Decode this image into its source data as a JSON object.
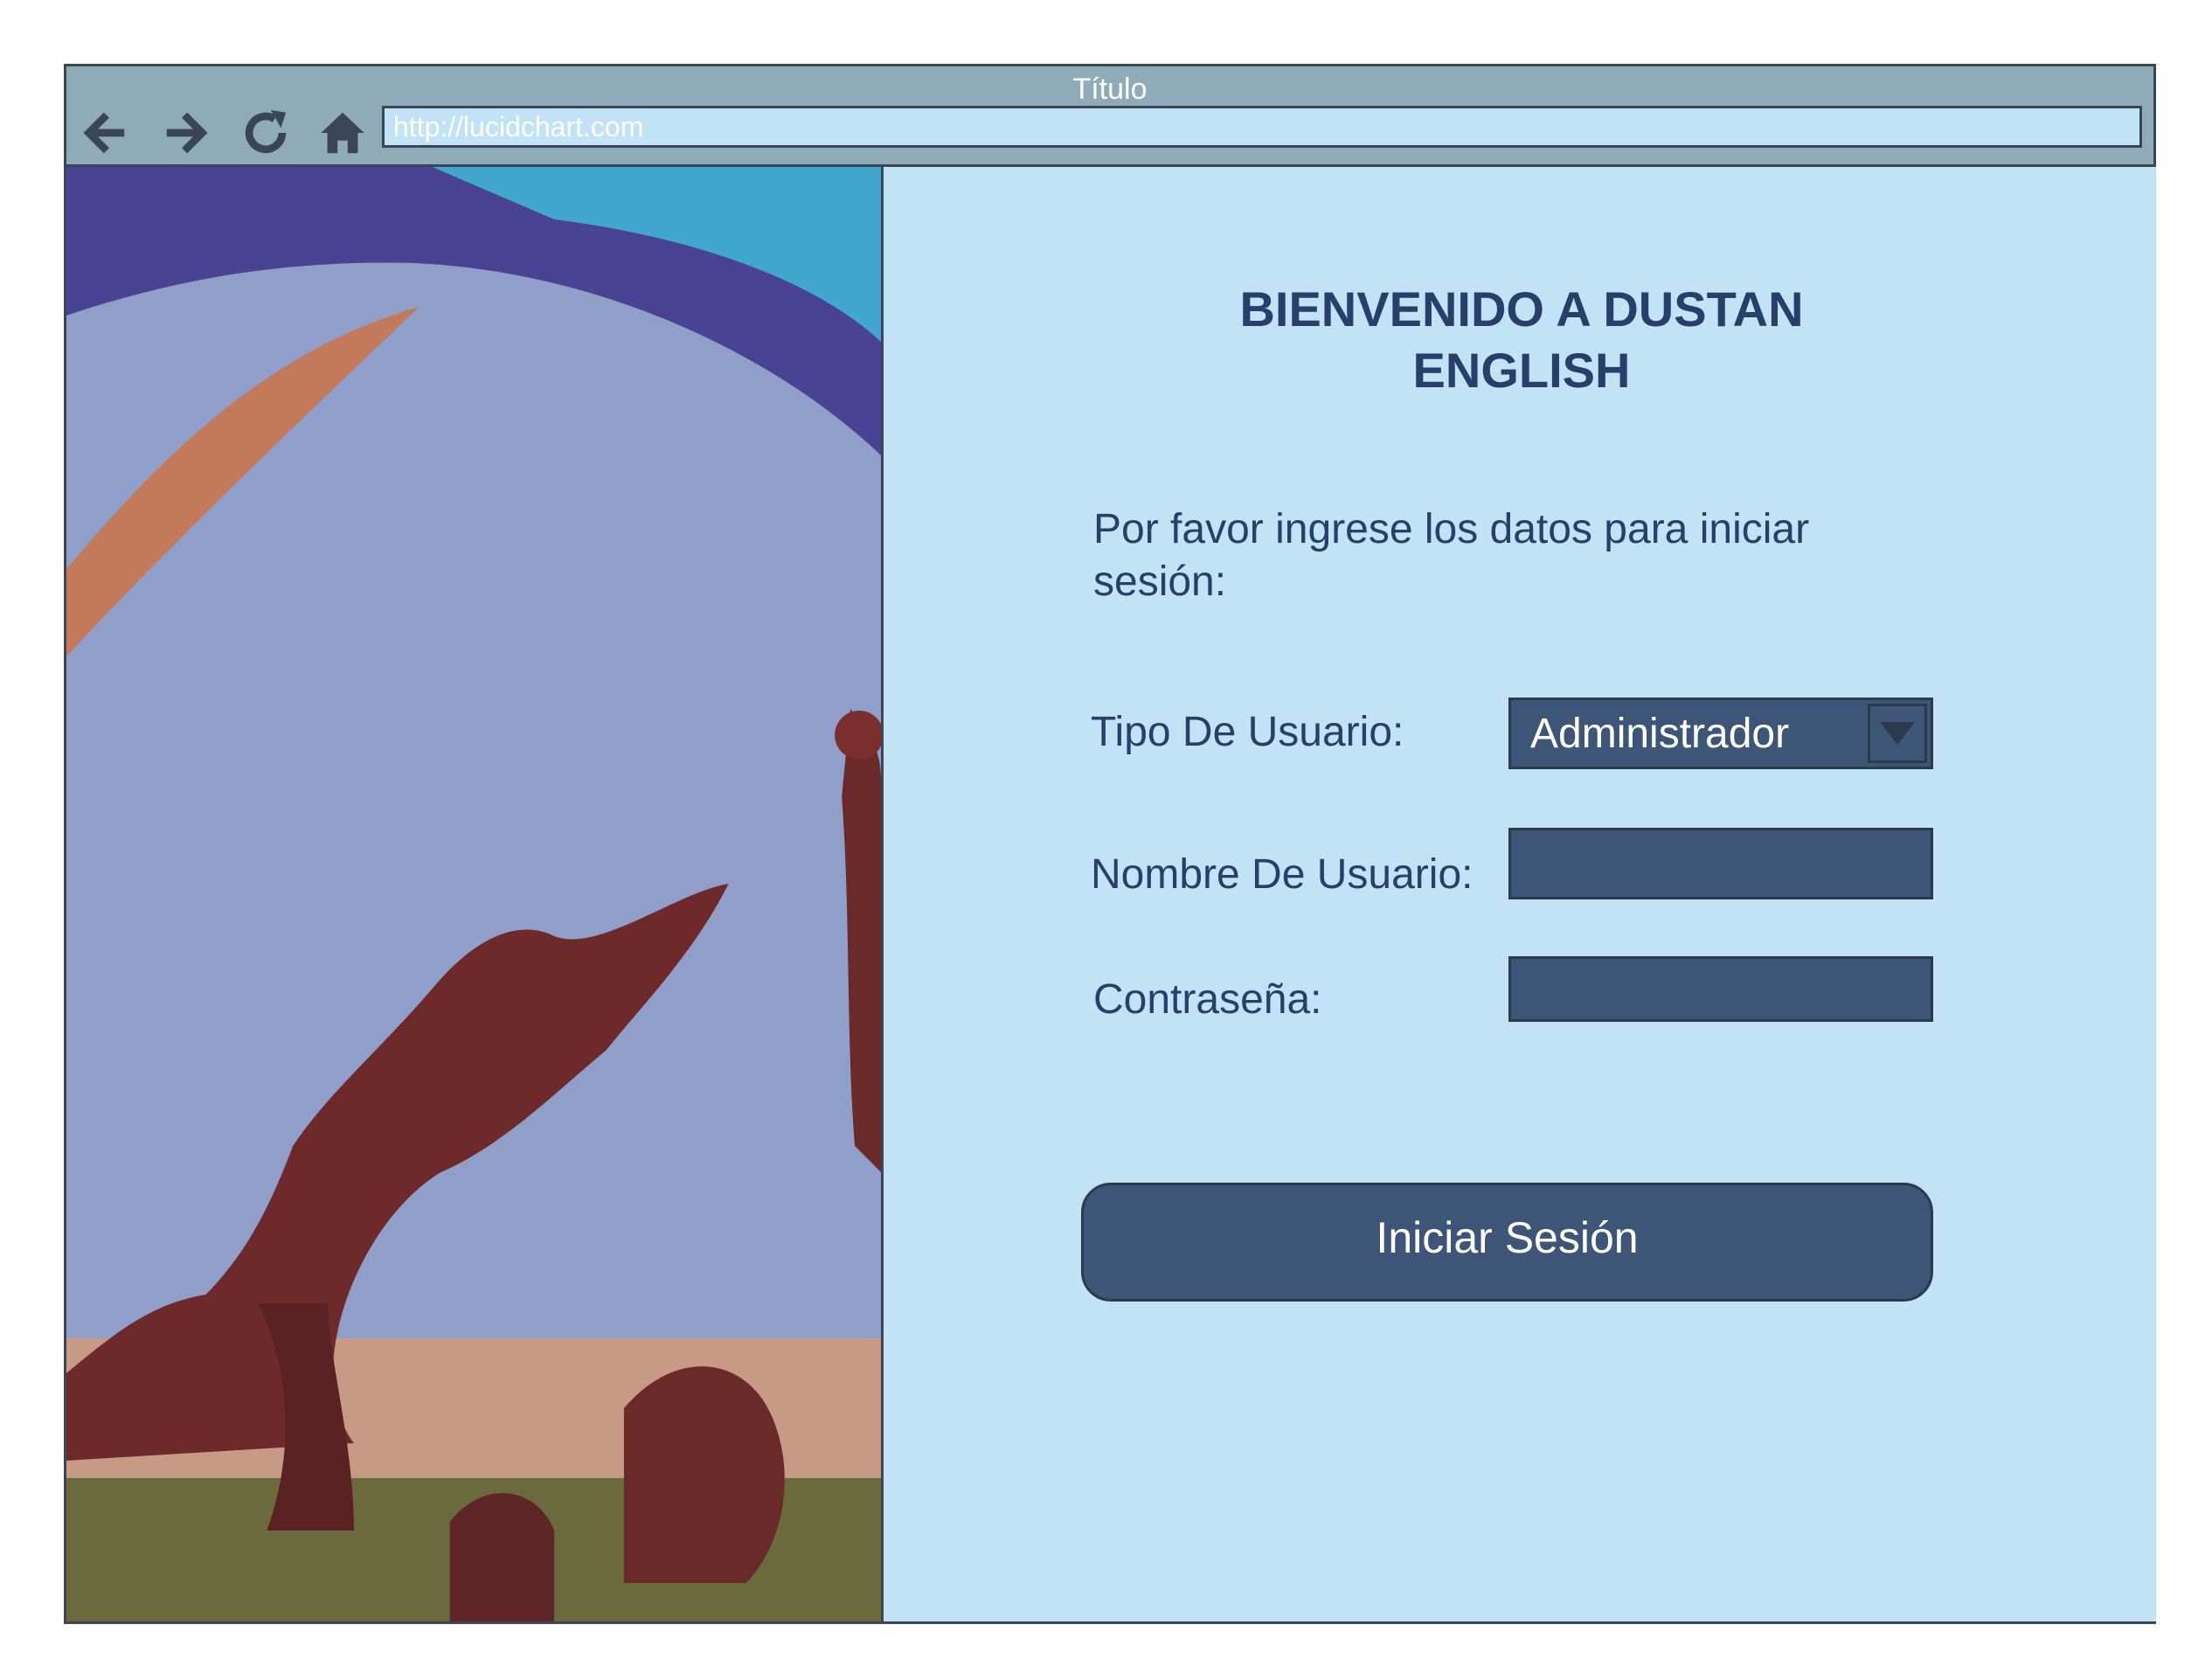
{
  "window": {
    "title": "Título",
    "address": "http://lucidchart.com"
  },
  "toolbar": {
    "icons": [
      "back-arrow-icon",
      "forward-arrow-icon",
      "refresh-icon",
      "home-icon"
    ]
  },
  "form": {
    "heading": "BIENVENIDO A DUSTAN ENGLISH",
    "instructions": "Por favor ingrese los datos para iniciar sesión:",
    "user_type_label": "Tipo De Usuario:",
    "user_type_value": "Administrador",
    "username_label": "Nombre De Usuario:",
    "username_value": "",
    "password_label": "Contraseña:",
    "password_value": "",
    "submit_label": "Iniciar Sesión"
  },
  "colors": {
    "panel_bg": "#c2e3f5",
    "chrome_bg": "#90abb8",
    "text": "#27406b",
    "control_bg": "#3d5577",
    "border": "#3a4656"
  }
}
